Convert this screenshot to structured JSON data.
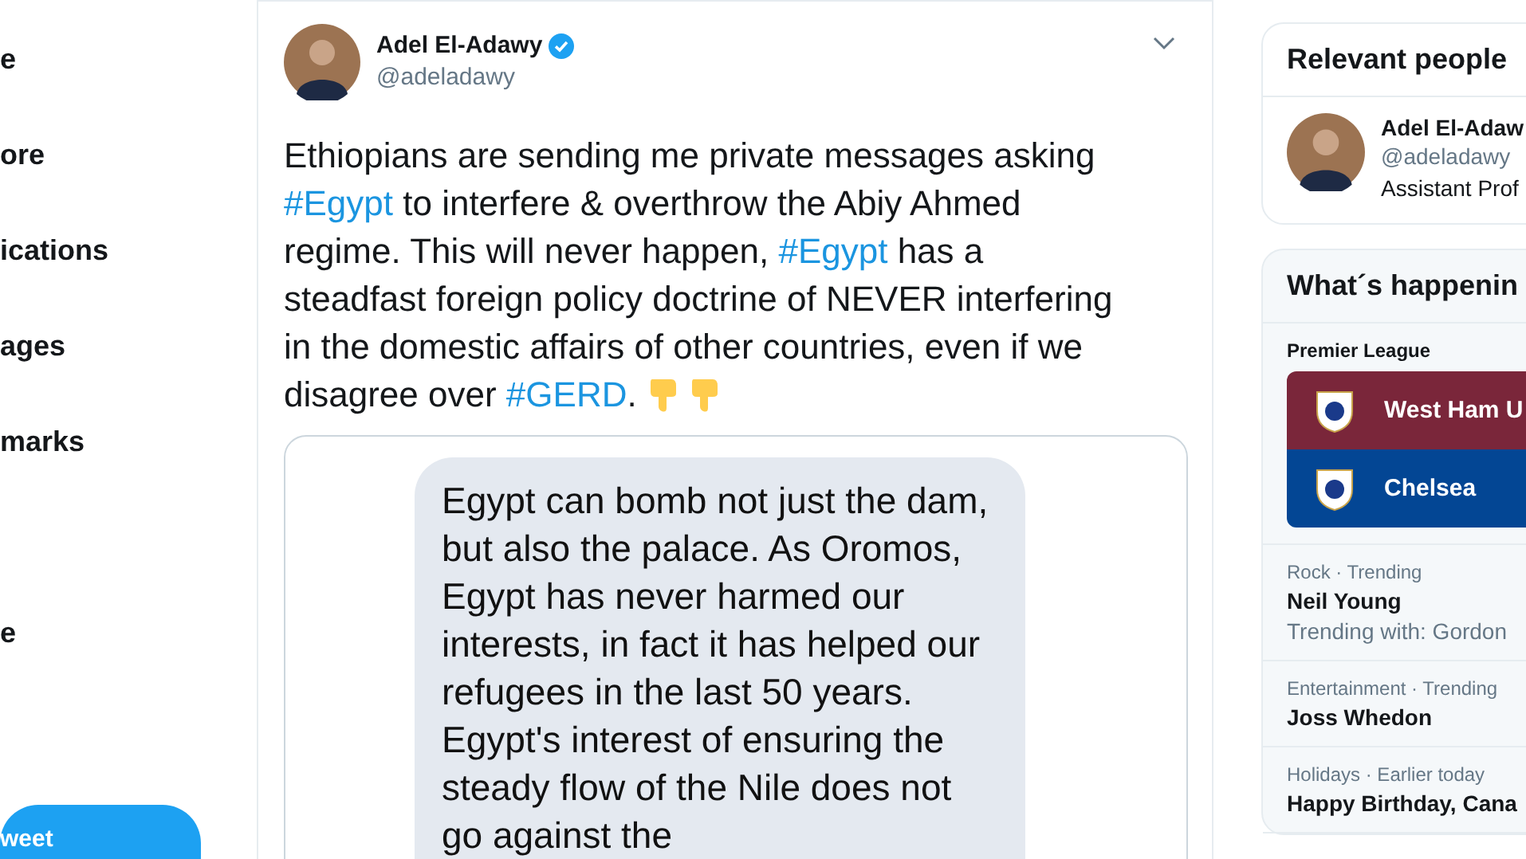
{
  "nav": {
    "items": [
      {
        "kind": "link",
        "label": "e"
      },
      {
        "kind": "link",
        "label": "ore"
      },
      {
        "kind": "link",
        "label": "ications"
      },
      {
        "kind": "link",
        "label": "ages"
      },
      {
        "kind": "link",
        "label": "marks"
      },
      {
        "kind": "spacer"
      },
      {
        "kind": "link",
        "label": "e"
      }
    ],
    "tweet_button": "weet"
  },
  "tweet": {
    "name": "Adel El-Adawy",
    "verified": true,
    "handle": "@adeladawy",
    "text": [
      {
        "kind": "text",
        "text": "Ethiopians are sending me private messages asking "
      },
      {
        "kind": "hashtag",
        "text": "#Egypt"
      },
      {
        "kind": "text",
        "text": " to interfere & overthrow the Abiy Ahmed regime. This will never happen, "
      },
      {
        "kind": "hashtag",
        "text": "#Egypt"
      },
      {
        "kind": "text",
        "text": " has a steadfast foreign policy doctrine of NEVER interfering in the domestic affairs of other countries, even if we disagree over "
      },
      {
        "kind": "hashtag",
        "text": "#GERD"
      },
      {
        "kind": "text",
        "text": ". "
      }
    ],
    "media": {
      "message_text": "Egypt can bomb not just the dam, but also the palace. As Oromos, Egypt has never harmed our interests, in fact it has helped our refugees in the last 50 years. Egypt's interest of ensuring the steady flow of the Nile does not go against the"
    }
  },
  "relevant_people": {
    "title": "Relevant people",
    "person": {
      "name": "Adel El-Adaw",
      "handle": "@adeladawy",
      "bio": "Assistant Prof"
    }
  },
  "trends": {
    "title": "What´s happenin",
    "event": {
      "league": "Premier League",
      "teams": [
        {
          "name": "West Ham U",
          "color": "#7a263a"
        },
        {
          "name": "Chelsea",
          "color": "#034694"
        }
      ]
    },
    "items": [
      {
        "context": "Rock · Trending",
        "title": "Neil Young",
        "detail": "Trending with: Gordon"
      },
      {
        "context": "Entertainment · Trending",
        "title": "Joss Whedon"
      },
      {
        "context": "Holidays · Earlier today",
        "title": "Happy Birthday, Cana"
      }
    ]
  }
}
